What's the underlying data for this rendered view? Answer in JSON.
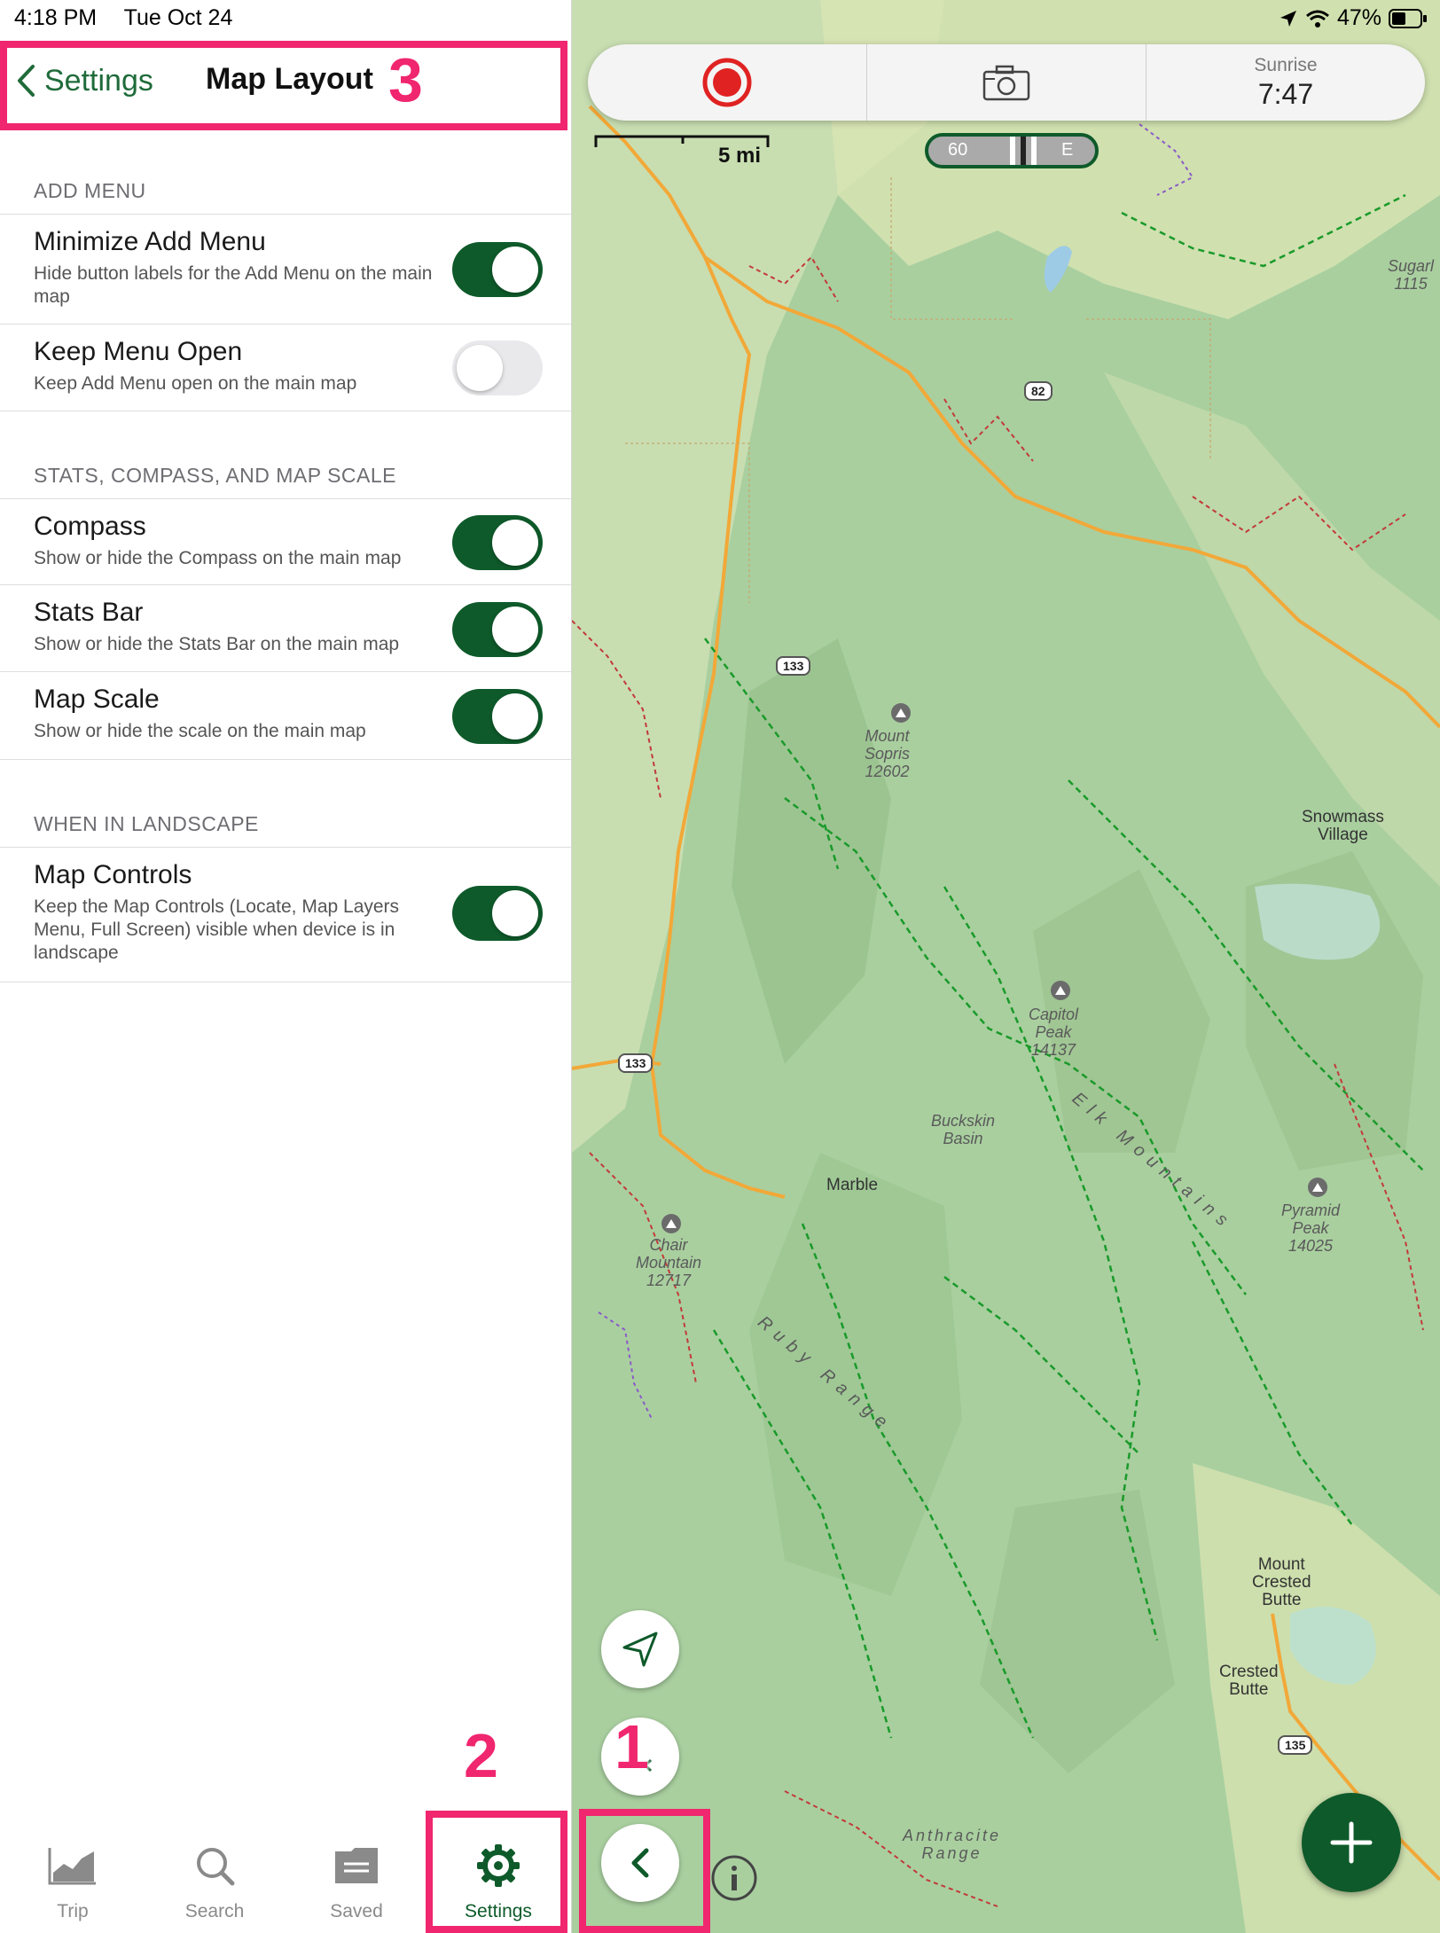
{
  "status": {
    "time": "4:18 PM",
    "date": "Tue Oct 24",
    "battery": "47%"
  },
  "nav": {
    "back_label": "Settings",
    "title": "Map Layout"
  },
  "sections": {
    "add_menu": {
      "header": "ADD MENU",
      "minimize": {
        "title": "Minimize Add Menu",
        "subtitle": "Hide button labels for the Add Menu on the main map",
        "on": true
      },
      "keep_open": {
        "title": "Keep Menu Open",
        "subtitle": "Keep Add Menu open on the main map",
        "on": false
      }
    },
    "stats": {
      "header": "STATS, COMPASS, AND MAP SCALE",
      "compass": {
        "title": "Compass",
        "subtitle": "Show or hide the Compass on the main map",
        "on": true
      },
      "stats_bar": {
        "title": "Stats Bar",
        "subtitle": "Show or hide the Stats Bar on the main map",
        "on": true
      },
      "map_scale": {
        "title": "Map Scale",
        "subtitle": "Show or hide the scale on the main map",
        "on": true
      }
    },
    "landscape": {
      "header": "WHEN IN LANDSCAPE",
      "map_controls": {
        "title": "Map Controls",
        "subtitle": "Keep the Map Controls (Locate, Map Layers Menu, Full Screen) visible when device is in landscape",
        "on": true
      }
    }
  },
  "tabs": [
    {
      "label": "Trip",
      "icon": "chart-icon"
    },
    {
      "label": "Search",
      "icon": "magnifier-icon"
    },
    {
      "label": "Saved",
      "icon": "folder-icon"
    },
    {
      "label": "Settings",
      "icon": "gear-icon",
      "active": true
    }
  ],
  "map": {
    "sunrise_label": "Sunrise",
    "sunrise_time": "7:47",
    "scale_label": "5 mi",
    "compass_60": "60",
    "compass_e": "E",
    "places": {
      "sugarloaf": "Sugarl\n1115",
      "mount_sopris": "Mount\nSopris\n12602",
      "snowmass": "Snowmass\nVillage",
      "capitol_peak": "Capitol\nPeak\n14137",
      "buckskin": "Buckskin\nBasin",
      "elk_mountains": "Elk Mountains",
      "marble": "Marble",
      "pyramid": "Pyramid\nPeak\n14025",
      "chair_mountain": "Chair\nMountain\n12717",
      "ruby_range": "Ruby Range",
      "mount_crested_butte": "Mount\nCrested\nButte",
      "crested_butte": "Crested\nButte",
      "anthracite": "Anthracite\nRange"
    },
    "roads": {
      "r82": "82",
      "r133a": "133",
      "r133b": "133",
      "r135": "135"
    }
  },
  "annotations": {
    "n1": "1",
    "n2": "2",
    "n3": "3"
  },
  "colors": {
    "accent": "#0e5a2a",
    "annotation": "#f0266f",
    "map_bg": "#a9cf9f"
  }
}
